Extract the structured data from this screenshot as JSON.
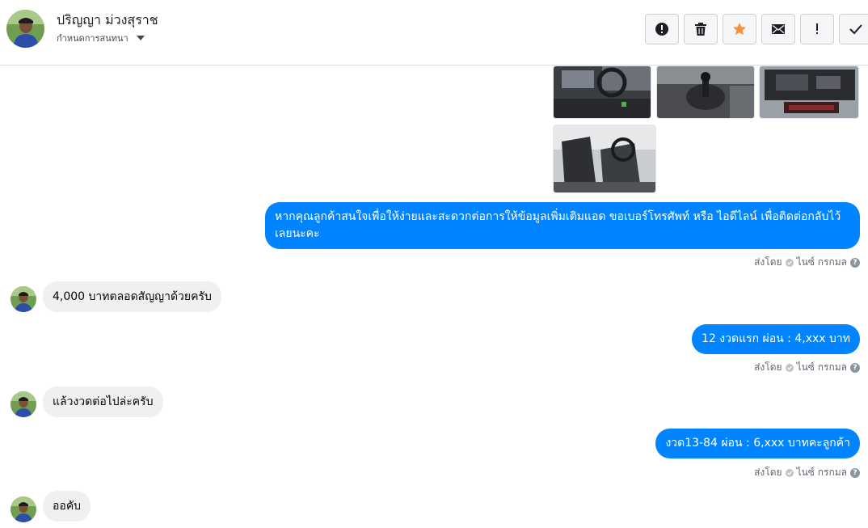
{
  "header": {
    "name": "ปริญญา ม่วงสุราช",
    "subtitle": "กำหนดการสนทนา"
  },
  "toolbar": {
    "buttons": [
      {
        "icon": "alert-circle-icon",
        "label": "Report"
      },
      {
        "icon": "trash-icon",
        "label": "Delete"
      },
      {
        "icon": "star-icon",
        "label": "Star",
        "color": "#f7923b"
      },
      {
        "icon": "envelope-icon",
        "label": "Mark unread"
      },
      {
        "icon": "exclamation-icon",
        "label": "Follow up"
      },
      {
        "icon": "checkmark-icon",
        "label": "Done"
      }
    ]
  },
  "messages": [
    {
      "side": "out",
      "text": "หากคุณลูกค้าสนใจเพื่อให้ง่ายและสะดวกต่อการให้ข้อมูลเพิ่มเติมแอด ขอเบอร์โทรศัพท์ หรือ ไอดีไลน์ เพื่อติดต่อกลับไว้เลยนะคะ"
    },
    {
      "side": "in",
      "text": "4,000 บาทตลอดสัญญาด้วยครับ"
    },
    {
      "side": "out",
      "text": "12 งวดแรก ผ่อน : 4,xxx บาท"
    },
    {
      "side": "in",
      "text": "แล้วงวดต่อไปล่ะครับ"
    },
    {
      "side": "out",
      "text": "งวด13-84 ผ่อน : 6,xxx บาทคะลูกค้า"
    },
    {
      "side": "in",
      "text": "ออคับ"
    }
  ],
  "sent_by": {
    "prefix": "ส่งโดย",
    "agent": "ไนซ์ กรกมล"
  },
  "colors": {
    "outgoing_bubble": "#0084ff",
    "incoming_bubble": "#f0f0f0",
    "star": "#f7923b"
  }
}
